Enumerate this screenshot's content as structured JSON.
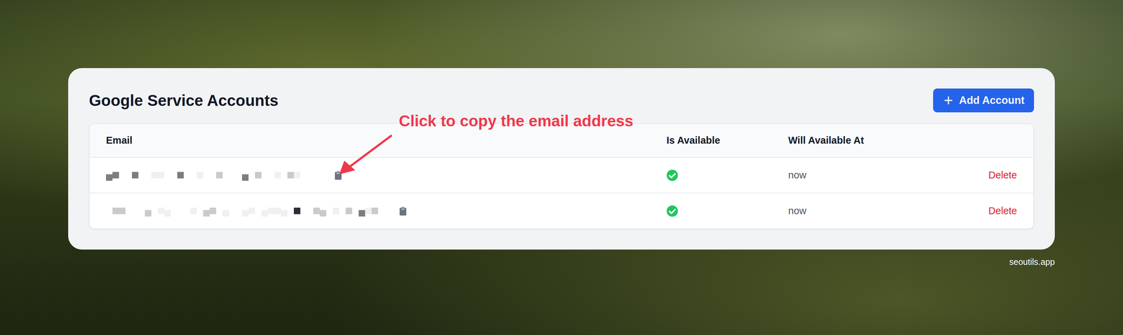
{
  "page": {
    "title": "Google Service Accounts",
    "add_button": "Add Account",
    "watermark": "seoutils.app"
  },
  "annotation": {
    "text": "Click to copy the email address"
  },
  "table": {
    "columns": [
      "Email",
      "Is Available",
      "Will Available At"
    ],
    "rows": [
      {
        "email_redacted": true,
        "available": true,
        "available_at": "now",
        "action": "Delete"
      },
      {
        "email_redacted": true,
        "available": true,
        "available_at": "now",
        "action": "Delete"
      }
    ]
  }
}
